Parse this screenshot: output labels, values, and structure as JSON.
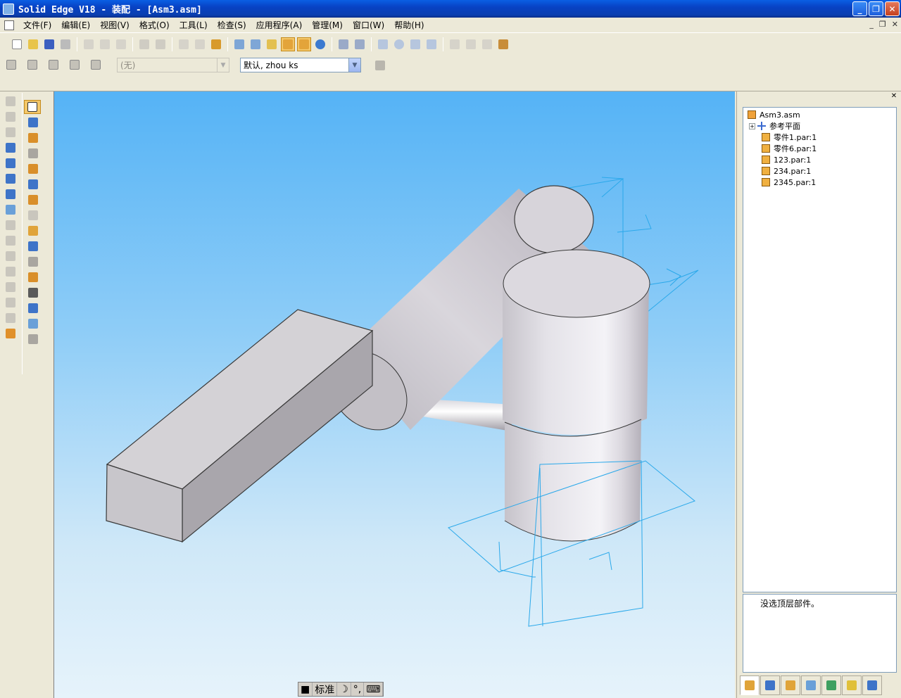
{
  "window": {
    "title": "Solid Edge V18 - 装配 - [Asm3.asm]",
    "minimize_label": "_",
    "restore_label": "❐",
    "close_label": "✕"
  },
  "menu": {
    "items": [
      "文件(F)",
      "编辑(E)",
      "视图(V)",
      "格式(O)",
      "工具(L)",
      "检查(S)",
      "应用程序(A)",
      "管理(M)",
      "窗口(W)",
      "帮助(H)"
    ]
  },
  "toolbar2": {
    "style_combo": "(无)",
    "config_combo": "默认, zhou ks"
  },
  "pathfinder": {
    "root": "Asm3.asm",
    "ref_planes": "参考平面",
    "parts": [
      "零件1.par:1",
      "零件6.par:1",
      "123.par:1",
      "234.par:1",
      "2345.par:1"
    ],
    "prompt": "没选顶层部件。"
  },
  "ime": {
    "mode": "标准",
    "moon": "☽",
    "punct": "°,"
  },
  "colors": {
    "titlebar": "#0a4fd6",
    "viewport_top": "#55b3f6",
    "viewport_bottom": "#e6f3fb",
    "ref_plane": "#2aa8ea",
    "part_fill": "#cfccd3"
  }
}
